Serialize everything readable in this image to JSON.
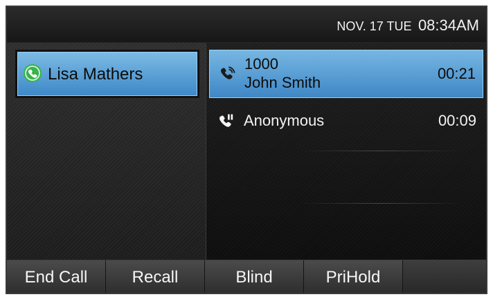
{
  "status_bar": {
    "date": "NOV. 17 TUE",
    "time": "08:34AM"
  },
  "contact": {
    "name": "Lisa Mathers",
    "icon": "phone-active-green-icon"
  },
  "calls": [
    {
      "number": "1000",
      "name": "John Smith",
      "duration": "00:21",
      "state_icon": "phone-talking-icon"
    },
    {
      "name": "Anonymous",
      "duration": "00:09",
      "state_icon": "phone-hold-icon"
    }
  ],
  "softkeys": [
    {
      "label": "End Call"
    },
    {
      "label": "Recall"
    },
    {
      "label": "Blind"
    },
    {
      "label": "PriHold"
    },
    {
      "label": ""
    }
  ],
  "colors": {
    "accent": "#4b93d0",
    "accent_light": "#76b6e2",
    "active_green": "#37b34a"
  }
}
